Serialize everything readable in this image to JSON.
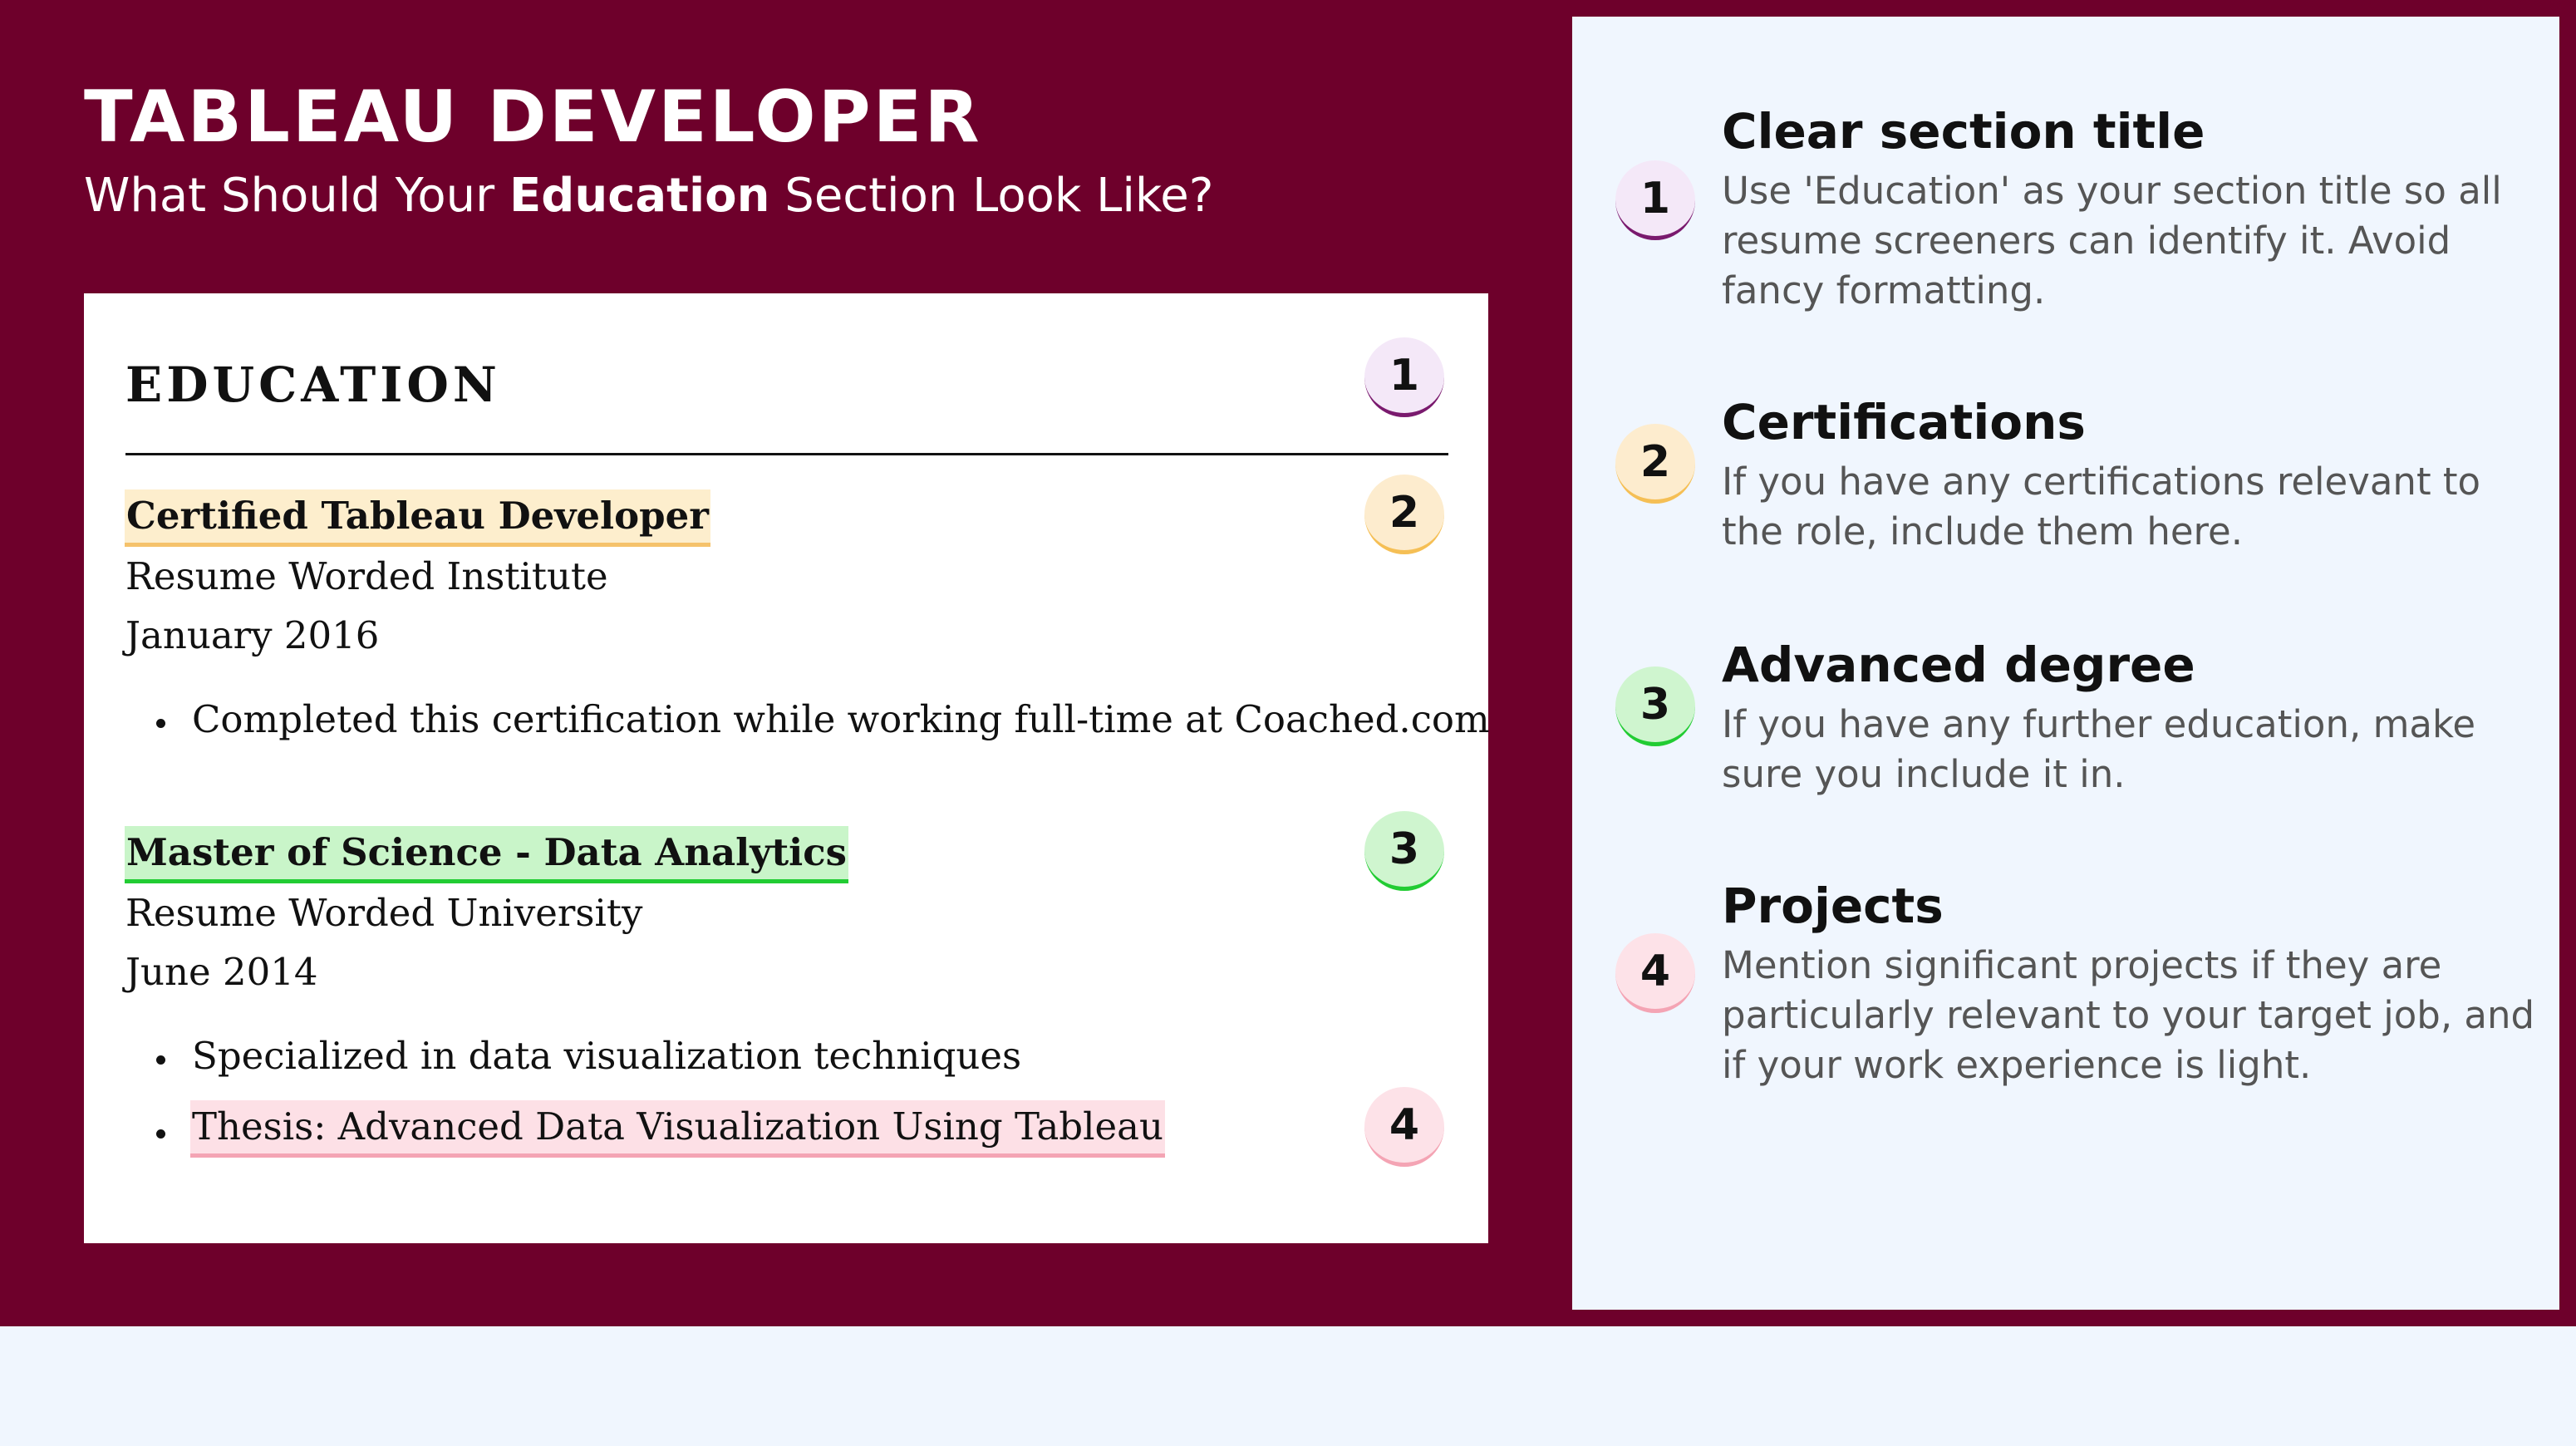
{
  "header": {
    "title": "TABLEAU DEVELOPER",
    "subtitle_pre": "What Should Your ",
    "subtitle_bold": "Education",
    "subtitle_post": " Section Look Like?"
  },
  "resume": {
    "section_title": "EDUCATION",
    "entries": [
      {
        "degree": "Certified Tableau Developer",
        "institution": "Resume Worded Institute",
        "date": "January 2016",
        "bullets": [
          "Completed this certification while working full-time at Coached.com"
        ]
      },
      {
        "degree": "Master of Science - Data Analytics",
        "institution": "Resume Worded University",
        "date": "June 2014",
        "bullets": [
          "Specialized in data visualization techniques",
          "Thesis: Advanced Data Visualization Using Tableau"
        ]
      }
    ],
    "badges": [
      "1",
      "2",
      "3",
      "4"
    ]
  },
  "tips": [
    {
      "number": "1",
      "title": "Clear section title",
      "body": "Use 'Education' as your section title so all resume screeners can identify it. Avoid fancy formatting."
    },
    {
      "number": "2",
      "title": "Certifications",
      "body": "If you have any certifications relevant to the role, include them here."
    },
    {
      "number": "3",
      "title": "Advanced degree",
      "body": "If you have any further education, make sure you include it in."
    },
    {
      "number": "4",
      "title": "Projects",
      "body": "Mention significant projects if they are particularly relevant to your target job, and if your work experience is light."
    }
  ],
  "colors": {
    "background_maroon": "#6e002b",
    "panel": "#f0f6fe",
    "badge1": "#7a1a6e",
    "badge2": "#f5bf55",
    "badge3": "#22cc33",
    "badge4": "#f4a4b4"
  }
}
